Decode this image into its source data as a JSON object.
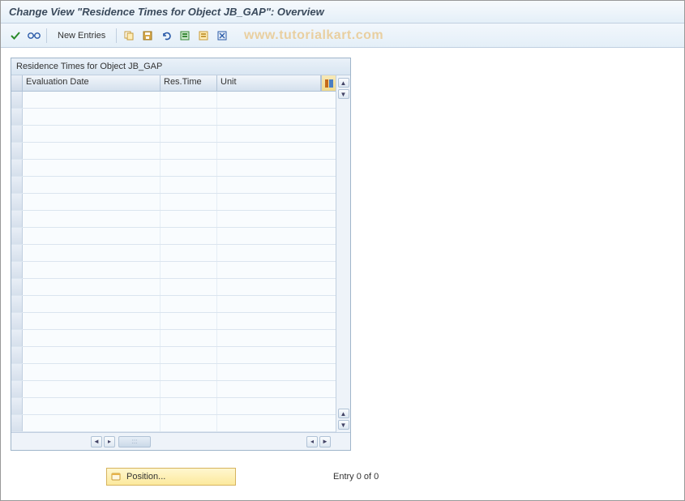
{
  "title": "Change View \"Residence Times for Object JB_GAP\": Overview",
  "watermark": "www.tutorialkart.com",
  "toolbar": {
    "new_entries_label": "New Entries",
    "icons": {
      "check": "check-icon",
      "glasses": "display-icon",
      "copy": "copy-icon",
      "save": "save-icon",
      "undo": "undo-icon",
      "select_all": "select-all-icon",
      "deselect_all": "deselect-all-icon",
      "delete": "delete-icon"
    }
  },
  "panel": {
    "title": "Residence Times for Object JB_GAP",
    "columns": {
      "evaluation_date": "Evaluation Date",
      "res_time": "Res.Time",
      "unit": "Unit"
    },
    "row_count": 20
  },
  "footer": {
    "position_label": "Position...",
    "entry_text": "Entry 0 of 0"
  }
}
